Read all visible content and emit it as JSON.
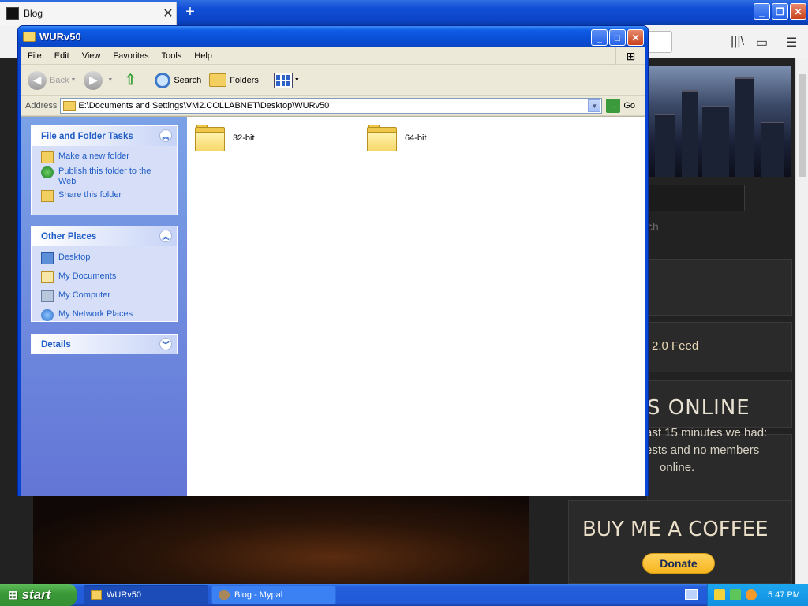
{
  "browser": {
    "tab_title": "Blog",
    "page": {
      "search_placeholder": "...",
      "search_label": "ch",
      "feed_text": "2.0 Feed",
      "online_heading": "S ONLINE",
      "online_lines": [
        "ast 15 minutes we had:",
        "ests and no members",
        "online."
      ],
      "coffee_heading": "BUY ME A COFFEE",
      "donate_label": "Donate"
    }
  },
  "explorer": {
    "title": "WURv50",
    "menu": [
      "File",
      "Edit",
      "View",
      "Favorites",
      "Tools",
      "Help"
    ],
    "toolbar": {
      "back": "Back",
      "search": "Search",
      "folders": "Folders"
    },
    "address": {
      "label": "Address",
      "path": "E:\\Documents and Settings\\VM2.COLLABNET\\Desktop\\WURv50",
      "go": "Go"
    },
    "taskpane": {
      "file_tasks": {
        "title": "File and Folder Tasks",
        "items": [
          "Make a new folder",
          "Publish this folder to the Web",
          "Share this folder"
        ]
      },
      "other_places": {
        "title": "Other Places",
        "items": [
          "Desktop",
          "My Documents",
          "My Computer",
          "My Network Places"
        ]
      },
      "details": {
        "title": "Details"
      }
    },
    "folders": [
      "32-bit",
      "64-bit"
    ]
  },
  "taskbar": {
    "start": "start",
    "tasks": [
      "WURv50",
      "Blog - Mypal"
    ],
    "clock": "5:47 PM"
  }
}
